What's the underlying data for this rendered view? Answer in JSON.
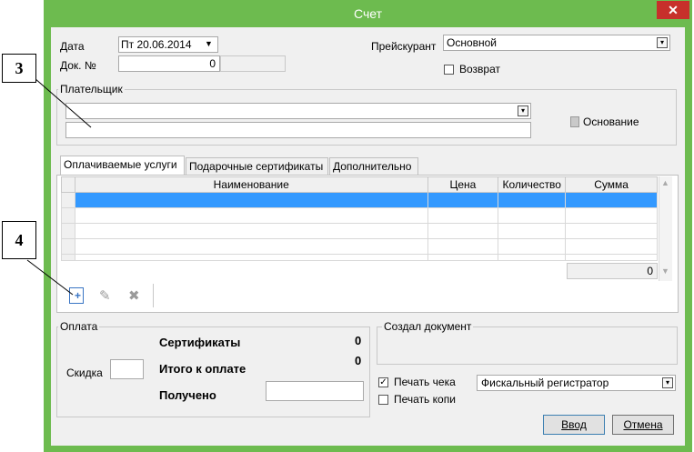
{
  "window": {
    "title": "Счет",
    "close_glyph": "✕"
  },
  "header": {
    "date_label": "Дата",
    "date_value": "Пт  20.06.2014",
    "doc_no_label": "Док. №",
    "doc_no_value": "0",
    "pricelist_label": "Прейскурант",
    "pricelist_value": "Основной",
    "return_label": "Возврат"
  },
  "payer": {
    "group_label": "Плательщик",
    "basis_label": "Основание"
  },
  "tabs": [
    {
      "label": "Оплачиваемые услуги"
    },
    {
      "label": "Подарочные сертификаты"
    },
    {
      "label": "Дополнительно"
    }
  ],
  "grid": {
    "columns": [
      "Наименование",
      "Цена",
      "Количество",
      "Сумма"
    ],
    "total": "0"
  },
  "payment": {
    "group_label": "Оплата",
    "certificates_label": "Сертификаты",
    "certificates_value": "0",
    "total_label": "Итого к оплате",
    "total_value": "0",
    "discount_label": "Скидка",
    "received_label": "Получено"
  },
  "creator": {
    "group_label": "Создал документ"
  },
  "print": {
    "receipt_label": "Печать чека",
    "copy_label": "Печать копи",
    "device_value": "Фискальный регистратор"
  },
  "buttons": {
    "ok": "Ввод",
    "cancel": "Отмена"
  },
  "callouts": {
    "c3": "3",
    "c4": "4"
  },
  "colors": {
    "titlebar": "#6dbb4f",
    "close": "#c7302b",
    "selection": "#3399ff"
  }
}
